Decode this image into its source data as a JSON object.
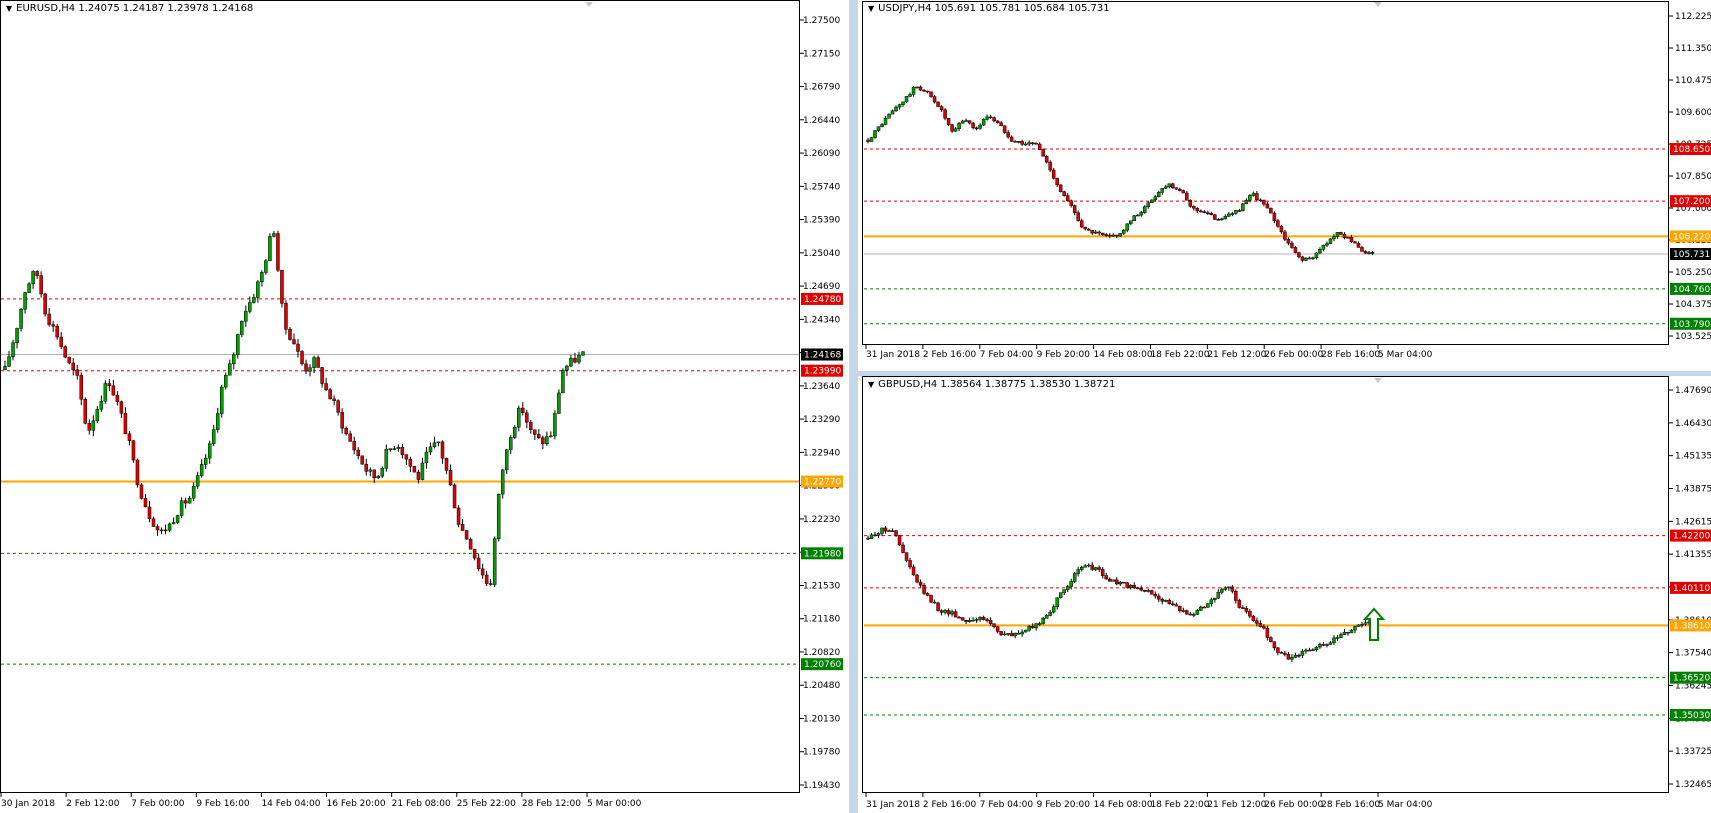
{
  "colors": {
    "up": "#00a000",
    "down": "#e00000",
    "resistance": "#e00000",
    "support": "#008000",
    "pivot": "#ffa500",
    "current": "#000000",
    "grid_line_current": "#b0b0b0",
    "arrow": "#008000"
  },
  "charts": [
    {
      "symbol_line": "EURUSD,H4  1.24075 1.24187 1.23978 1.24168",
      "price_scale": [
        "1.27500",
        "1.27150",
        "1.26790",
        "1.26440",
        "1.26090",
        "1.25740",
        "1.25390",
        "1.25040",
        "1.24690",
        "1.24340",
        "1.23990",
        "1.23640",
        "1.23290",
        "1.22940",
        "1.22580",
        "1.22230",
        "1.21880",
        "1.21530",
        "1.21180",
        "1.20820",
        "1.20480",
        "1.20130",
        "1.19780",
        "1.19430"
      ],
      "time_scale": [
        "30 Jan 2018",
        "2 Feb 12:00",
        "7 Feb 00:00",
        "9 Feb 16:00",
        "14 Feb 04:00",
        "16 Feb 20:00",
        "21 Feb 08:00",
        "25 Feb 22:00",
        "28 Feb 12:00",
        "5 Mar 00:00"
      ],
      "levels": [
        {
          "label": "1.24780",
          "kind": "resistance"
        },
        {
          "label": "1.24168",
          "kind": "current"
        },
        {
          "label": "1.23990",
          "kind": "resistance"
        },
        {
          "label": "1.22770",
          "kind": "pivot"
        },
        {
          "label": "1.21980",
          "kind": "support"
        },
        {
          "label": "1.20760",
          "kind": "support"
        }
      ],
      "chart_data": {
        "type": "candlestick",
        "ylim": [
          1.1943,
          1.2785
        ],
        "close_path": [
          1.24,
          1.244,
          1.249,
          1.251,
          1.246,
          1.244,
          1.241,
          1.239,
          1.233,
          1.236,
          1.239,
          1.236,
          1.232,
          1.227,
          1.224,
          1.222,
          1.223,
          1.225,
          1.226,
          1.229,
          1.232,
          1.238,
          1.241,
          1.246,
          1.248,
          1.251,
          1.256,
          1.245,
          1.243,
          1.24,
          1.241,
          1.238,
          1.236,
          1.233,
          1.231,
          1.229,
          1.228,
          1.231,
          1.232,
          1.23,
          1.228,
          1.231,
          1.232,
          1.228,
          1.223,
          1.221,
          1.218,
          1.216,
          1.228,
          1.233,
          1.236,
          1.233,
          1.232,
          1.233,
          1.24,
          1.241,
          1.2417
        ]
      }
    },
    {
      "symbol_line": "USDJPY,H4  105.691 105.781 105.684 105.731",
      "price_scale": [
        "112.225",
        "111.350",
        "110.475",
        "109.600",
        "108.725",
        "107.850",
        "107.000",
        "106.125",
        "105.250",
        "104.375",
        "103.525"
      ],
      "time_scale": [
        "31 Jan 2018",
        "2 Feb 16:00",
        "7 Feb 04:00",
        "9 Feb 20:00",
        "14 Feb 08:00",
        "18 Feb 22:00",
        "21 Feb 12:00",
        "26 Feb 00:00",
        "28 Feb 16:00",
        "5 Mar 04:00"
      ],
      "levels": [
        {
          "label": "108.650",
          "kind": "resistance"
        },
        {
          "label": "107.200",
          "kind": "resistance"
        },
        {
          "label": "106.220",
          "kind": "pivot"
        },
        {
          "label": "105.731",
          "kind": "current"
        },
        {
          "label": "104.760",
          "kind": "support"
        },
        {
          "label": "103.790",
          "kind": "support"
        }
      ],
      "chart_data": {
        "type": "candlestick",
        "ylim": [
          103.45,
          112.35
        ],
        "close_path": [
          108.9,
          109.3,
          109.7,
          110.0,
          110.4,
          110.2,
          109.8,
          109.1,
          109.5,
          109.2,
          109.6,
          109.3,
          108.9,
          108.8,
          108.8,
          108.2,
          107.5,
          107.0,
          106.4,
          106.3,
          106.2,
          106.3,
          106.7,
          107.0,
          107.4,
          107.7,
          107.5,
          107.0,
          106.9,
          106.7,
          106.8,
          107.0,
          107.4,
          107.1,
          106.6,
          106.0,
          105.6,
          105.6,
          106.0,
          106.3,
          106.2,
          105.8,
          105.731
        ]
      }
    },
    {
      "symbol_line": "GBPUSD,H4  1.38564 1.38775 1.38530 1.38721",
      "price_scale": [
        "1.47690",
        "1.46430",
        "1.45135",
        "1.43875",
        "1.42615",
        "1.41355",
        "1.40110",
        "1.38610",
        "1.37540",
        "1.36245",
        "1.34985",
        "1.33725",
        "1.32465"
      ],
      "time_scale": [
        "31 Jan 2018",
        "2 Feb 16:00",
        "7 Feb 04:00",
        "9 Feb 20:00",
        "14 Feb 08:00",
        "18 Feb 22:00",
        "21 Feb 12:00",
        "26 Feb 00:00",
        "28 Feb 16:00",
        "5 Mar 04:00"
      ],
      "levels": [
        {
          "label": "1.42200",
          "kind": "resistance"
        },
        {
          "label": "1.40110",
          "kind": "resistance"
        },
        {
          "label": "1.38610",
          "kind": "pivot"
        },
        {
          "label": "1.36520",
          "kind": "support"
        },
        {
          "label": "1.35030",
          "kind": "support"
        }
      ],
      "chart_data": {
        "type": "candlestick",
        "ylim": [
          1.3227,
          1.4802
        ],
        "close_path": [
          1.421,
          1.424,
          1.425,
          1.414,
          1.404,
          1.397,
          1.392,
          1.391,
          1.388,
          1.389,
          1.388,
          1.383,
          1.382,
          1.384,
          1.386,
          1.391,
          1.398,
          1.405,
          1.41,
          1.409,
          1.404,
          1.403,
          1.401,
          1.4,
          1.398,
          1.395,
          1.392,
          1.391,
          1.394,
          1.398,
          1.402,
          1.393,
          1.389,
          1.384,
          1.376,
          1.373,
          1.375,
          1.377,
          1.378,
          1.381,
          1.384,
          1.387,
          1.3872
        ]
      }
    }
  ]
}
